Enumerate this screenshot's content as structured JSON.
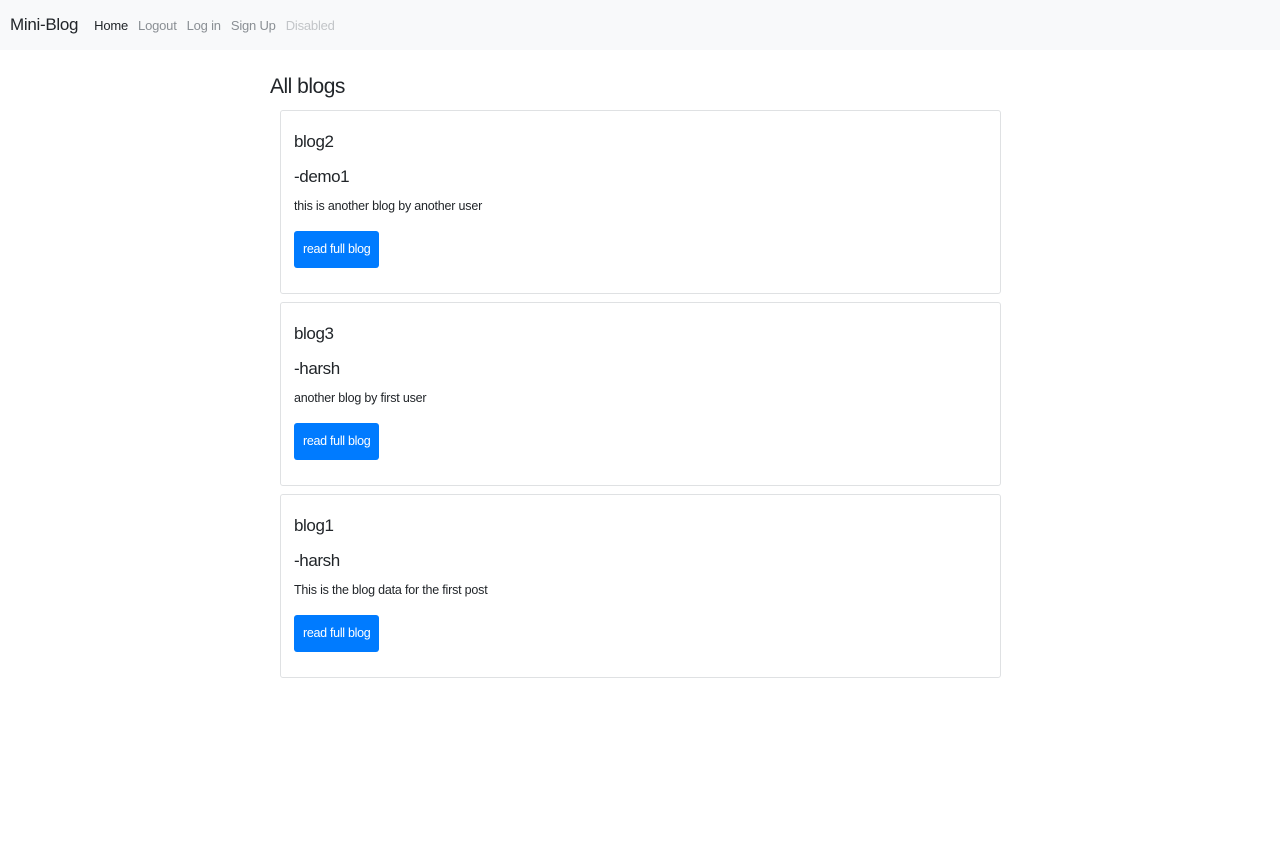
{
  "navbar": {
    "brand": "Mini-Blog",
    "links": [
      {
        "label": "Home",
        "state": "active"
      },
      {
        "label": "Logout",
        "state": "normal"
      },
      {
        "label": "Log in",
        "state": "normal"
      },
      {
        "label": "Sign Up",
        "state": "normal"
      },
      {
        "label": "Disabled",
        "state": "disabled"
      }
    ]
  },
  "main": {
    "title": "All blogs",
    "blogs": [
      {
        "title": "blog2",
        "author": "-demo1",
        "text": "this is another blog by another user",
        "button": "read full blog"
      },
      {
        "title": "blog3",
        "author": "-harsh",
        "text": "another blog by first user",
        "button": "read full blog"
      },
      {
        "title": "blog1",
        "author": "-harsh",
        "text": "This is the blog data for the first post",
        "button": "read full blog"
      }
    ]
  },
  "colors": {
    "primary": "#007bff",
    "navbar_bg": "#f8f9fa",
    "text": "#212529",
    "muted_link": "#8a8f94",
    "disabled_link": "#c2c5c8"
  }
}
